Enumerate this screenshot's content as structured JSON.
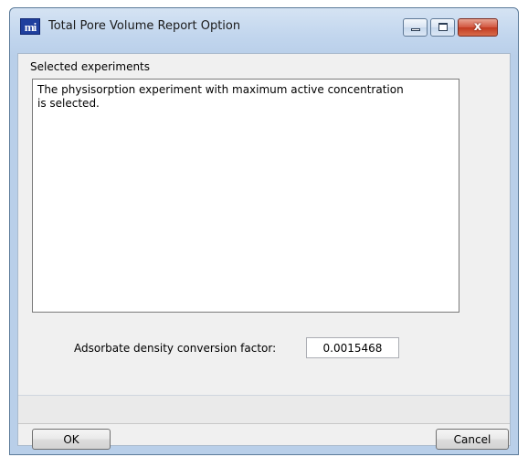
{
  "window": {
    "title": "Total Pore Volume Report Option",
    "app_icon_text": "mi",
    "controls": {
      "minimize": "minimize",
      "maximize": "maximize",
      "close": "x"
    }
  },
  "experiments": {
    "label": "Selected experiments",
    "text": "The physisorption experiment with maximum active concentration\nis selected."
  },
  "density": {
    "label": "Adsorbate density conversion factor:",
    "value": "0.0015468"
  },
  "buttons": {
    "ok": "OK",
    "cancel": "Cancel"
  },
  "colors": {
    "title_bar": "#c2d6ee",
    "close_button": "#c23a20",
    "client_background": "#f0f0f0"
  }
}
